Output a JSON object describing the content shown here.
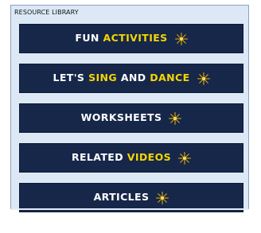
{
  "library": {
    "title": "RESOURCE LIBRARY",
    "buttons": [
      {
        "name": "fun-activities-button",
        "parts": [
          {
            "text": "FUN ",
            "color": "white"
          },
          {
            "text": "ACTIVITIES",
            "color": "yellow"
          }
        ]
      },
      {
        "name": "lets-sing-and-dance-button",
        "parts": [
          {
            "text": "LET'S ",
            "color": "white"
          },
          {
            "text": "SING",
            "color": "yellow"
          },
          {
            "text": " AND ",
            "color": "white"
          },
          {
            "text": "DANCE",
            "color": "yellow"
          }
        ]
      },
      {
        "name": "worksheets-button",
        "parts": [
          {
            "text": "WORKSHEETS",
            "color": "white"
          }
        ]
      },
      {
        "name": "related-videos-button",
        "parts": [
          {
            "text": "RELATED ",
            "color": "white"
          },
          {
            "text": "VIDEOS",
            "color": "yellow"
          }
        ]
      },
      {
        "name": "articles-button",
        "parts": [
          {
            "text": "ARTICLES",
            "color": "white"
          }
        ]
      }
    ]
  },
  "colors": {
    "button_bg": "#16274a",
    "accent_yellow": "#f5d600",
    "panel_bg": "#dce8f5"
  },
  "icons": {
    "button_icon": "sparkle-star-icon"
  }
}
